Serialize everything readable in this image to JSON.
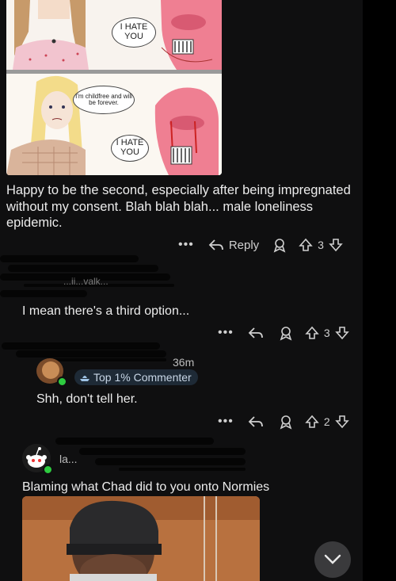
{
  "post": {
    "meme": {
      "top_bubble": "I HATE YOU",
      "middle_bubble": "I'm childfree and will be forever.",
      "bottom_bubble": "I HATE YOU"
    },
    "text": "Happy to be the second, especially after being impregnated without my consent. Blah blah blah... male loneliness epidemic.",
    "actions": {
      "more": "•••",
      "reply_label": "Reply",
      "votes": "3"
    }
  },
  "comment1": {
    "username_partial": "...ii...valk...",
    "text": "I mean there's a third option...",
    "actions": {
      "more": "•••",
      "votes": "3"
    }
  },
  "comment2": {
    "time": "36m",
    "badge": "Top 1% Commenter",
    "text": "Shh, don't tell her.",
    "actions": {
      "more": "•••",
      "votes": "2"
    }
  },
  "comment3": {
    "username_partial": "la...",
    "text": "Blaming what Chad did to you onto Normies"
  },
  "colors": {
    "background": "#0f0f10",
    "online": "#2ecc40",
    "badge_bg": "#1e2a36"
  },
  "icons": [
    "reply-icon",
    "award-icon",
    "upvote-icon",
    "downvote-icon",
    "chevron-down-icon"
  ]
}
